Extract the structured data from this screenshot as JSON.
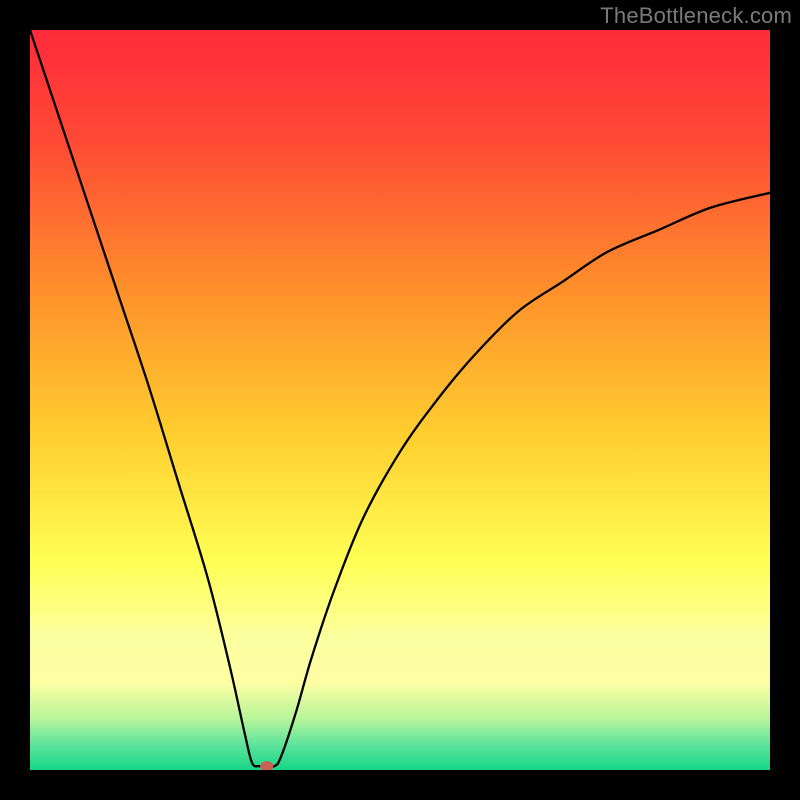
{
  "watermark": "TheBottleneck.com",
  "chart_data": {
    "type": "line",
    "xlabel": "",
    "ylabel": "",
    "xlim": [
      0,
      100
    ],
    "ylim": [
      0,
      100
    ],
    "grid": false,
    "gradient_stops": [
      {
        "offset": 0,
        "color": "#ff2a3a"
      },
      {
        "offset": 0.15,
        "color": "#ff4a35"
      },
      {
        "offset": 0.35,
        "color": "#ff8f2b"
      },
      {
        "offset": 0.55,
        "color": "#ffcf2f"
      },
      {
        "offset": 0.72,
        "color": "#ffff55"
      },
      {
        "offset": 0.82,
        "color": "#fcff9e"
      },
      {
        "offset": 0.88,
        "color": "#ffffa4"
      },
      {
        "offset": 0.93,
        "color": "#b9f59a"
      },
      {
        "offset": 0.965,
        "color": "#5fe49b"
      },
      {
        "offset": 1.0,
        "color": "#15d687"
      }
    ],
    "marker": {
      "x": 32,
      "y": 0.5,
      "r": 1.0,
      "color": "#c96055"
    },
    "series": [
      {
        "name": "curve",
        "points": [
          {
            "x": 0,
            "y": 100
          },
          {
            "x": 4,
            "y": 88
          },
          {
            "x": 8,
            "y": 76
          },
          {
            "x": 12,
            "y": 64
          },
          {
            "x": 16,
            "y": 52
          },
          {
            "x": 20,
            "y": 39
          },
          {
            "x": 24,
            "y": 26
          },
          {
            "x": 27,
            "y": 14
          },
          {
            "x": 29,
            "y": 5
          },
          {
            "x": 30,
            "y": 1
          },
          {
            "x": 31,
            "y": 0.5
          },
          {
            "x": 33,
            "y": 0.5
          },
          {
            "x": 34,
            "y": 2
          },
          {
            "x": 36,
            "y": 8
          },
          {
            "x": 38,
            "y": 15
          },
          {
            "x": 41,
            "y": 24
          },
          {
            "x": 45,
            "y": 34
          },
          {
            "x": 50,
            "y": 43
          },
          {
            "x": 55,
            "y": 50
          },
          {
            "x": 60,
            "y": 56
          },
          {
            "x": 66,
            "y": 62
          },
          {
            "x": 72,
            "y": 66
          },
          {
            "x": 78,
            "y": 70
          },
          {
            "x": 85,
            "y": 73
          },
          {
            "x": 92,
            "y": 76
          },
          {
            "x": 100,
            "y": 78
          }
        ]
      }
    ]
  }
}
